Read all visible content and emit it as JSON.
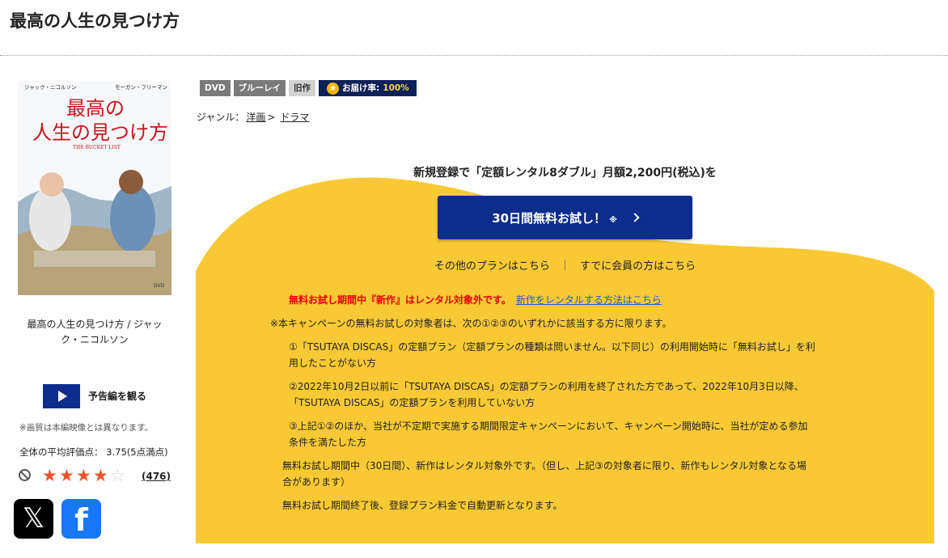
{
  "page": {
    "title": "最高の人生の見つけ方"
  },
  "poster": {
    "cast_left": "ジャック・ニコルソン",
    "cast_right": "モーガン・フリーマン",
    "title_line1": "最高の",
    "title_line2": "人生の見つけ方",
    "subtitle": "THE BUCKET LIST",
    "format": "DVD"
  },
  "left": {
    "title": "最高の人生の見つけ方 / ジャック・ニコルソン",
    "trailer_label": "予告編を観る",
    "quality_note": "※画質は本編映像とは異なります。",
    "rating_label": "全体の平均評価点： 3.75(5点満点)",
    "rating_value": 3.75,
    "review_count": "476",
    "review_count_display": "(476)",
    "x_glyph": "𝕏",
    "fb_glyph": "f"
  },
  "badges": {
    "dvd": "DVD",
    "bluray": "ブルーレイ",
    "old": "旧作",
    "delivery_label": "お届け率:",
    "delivery_rate": "100%"
  },
  "genre": {
    "label": "ジャンル：",
    "parent": "洋画",
    "separator": ">",
    "child": "ドラマ"
  },
  "promo": {
    "headline": "新規登録で「定額レンタル8ダブル」月額2,200円(税込)を",
    "trial_button": "30日間無料お試し！",
    "trial_mark": "※",
    "other_plans": "その他のプランはこちら",
    "separator": "｜",
    "member_link": "すでに会員の方はこちら",
    "warning": "無料お試し期間中『新作』はレンタル対象外です。",
    "warning_link": "新作をレンタルする方法はこちら",
    "note_intro": "※本キャンペーンの無料お試しの対象者は、次の①②③のいずれかに該当する方に限ります。",
    "cond1_l1": "①「TSUTAYA DISCAS」の定額プラン（定額プランの種類は問いません。以下同じ）の利用開始時に「無料お試し」を利",
    "cond1_l2": "用したことがない方",
    "cond2_l1": "②2022年10月2日以前に「TSUTAYA DISCAS」の定額プランの利用を終了された方であって、2022年10月3日以降、",
    "cond2_l2": "「TSUTAYA DISCAS」の定額プランを利用していない方",
    "cond3_l1": "③上記①②のほか、当社が不定期で実施する期間限定キャンペーンにおいて、キャンペーン開始時に、当社が定める参加",
    "cond3_l2": "条件を満たした方",
    "note2_l1": "無料お試し期間中（30日間）、新作はレンタル対象外です。（但し、上記③の対象者に限り、新作もレンタル対象となる場",
    "note2_l2": "合があります）",
    "note3": "無料お試し期間終了後、登録プラン料金で自動更新となります。"
  },
  "colors": {
    "navy": "#0d2d8c",
    "yellow": "#f8c934",
    "red": "#e60012",
    "link": "#1a5ad7"
  }
}
